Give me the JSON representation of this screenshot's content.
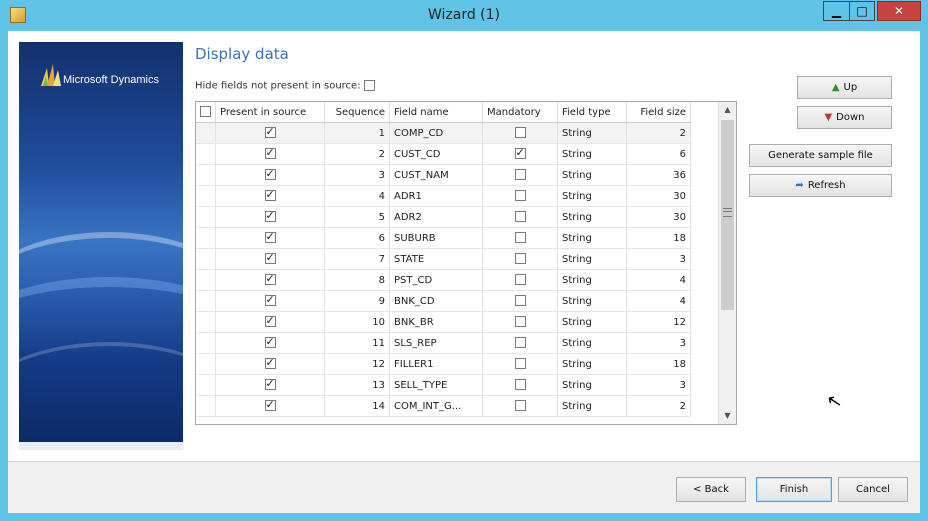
{
  "window": {
    "title": "Wizard (1)",
    "controls": {
      "minimize": "▁",
      "maximize": "□",
      "close": "✕"
    }
  },
  "banner": {
    "logo_text": "Microsoft Dynamics",
    "logo_icon": "microsoft-dynamics-logo-icon"
  },
  "page": {
    "heading": "Display data",
    "hide_fields_label": "Hide fields not present in source:",
    "hide_fields_checked": false
  },
  "grid": {
    "columns": [
      "Present in source",
      "Sequence",
      "Field name",
      "Mandatory",
      "Field type",
      "Field size"
    ],
    "rows": [
      {
        "present": true,
        "sequence": "1",
        "field_name": "COMP_CD",
        "mandatory": false,
        "field_type": "String",
        "field_size": "2"
      },
      {
        "present": true,
        "sequence": "2",
        "field_name": "CUST_CD",
        "mandatory": true,
        "field_type": "String",
        "field_size": "6"
      },
      {
        "present": true,
        "sequence": "3",
        "field_name": "CUST_NAM",
        "mandatory": false,
        "field_type": "String",
        "field_size": "36"
      },
      {
        "present": true,
        "sequence": "4",
        "field_name": "ADR1",
        "mandatory": false,
        "field_type": "String",
        "field_size": "30"
      },
      {
        "present": true,
        "sequence": "5",
        "field_name": "ADR2",
        "mandatory": false,
        "field_type": "String",
        "field_size": "30"
      },
      {
        "present": true,
        "sequence": "6",
        "field_name": "SUBURB",
        "mandatory": false,
        "field_type": "String",
        "field_size": "18"
      },
      {
        "present": true,
        "sequence": "7",
        "field_name": "STATE",
        "mandatory": false,
        "field_type": "String",
        "field_size": "3"
      },
      {
        "present": true,
        "sequence": "8",
        "field_name": "PST_CD",
        "mandatory": false,
        "field_type": "String",
        "field_size": "4"
      },
      {
        "present": true,
        "sequence": "9",
        "field_name": "BNK_CD",
        "mandatory": false,
        "field_type": "String",
        "field_size": "4"
      },
      {
        "present": true,
        "sequence": "10",
        "field_name": "BNK_BR",
        "mandatory": false,
        "field_type": "String",
        "field_size": "12"
      },
      {
        "present": true,
        "sequence": "11",
        "field_name": "SLS_REP",
        "mandatory": false,
        "field_type": "String",
        "field_size": "3"
      },
      {
        "present": true,
        "sequence": "12",
        "field_name": "FILLER1",
        "mandatory": false,
        "field_type": "String",
        "field_size": "18"
      },
      {
        "present": true,
        "sequence": "13",
        "field_name": "SELL_TYPE",
        "mandatory": false,
        "field_type": "String",
        "field_size": "3"
      },
      {
        "present": true,
        "sequence": "14",
        "field_name": "COM_INT_G...",
        "mandatory": false,
        "field_type": "String",
        "field_size": "2"
      }
    ]
  },
  "buttons": {
    "up": "Up",
    "down": "Down",
    "generate": "Generate sample file",
    "refresh": "Refresh",
    "back": "< Back",
    "finish": "Finish",
    "cancel": "Cancel"
  },
  "colors": {
    "title_bar": "#5fc4e6",
    "heading": "#3a73b8",
    "close_button": "#c7433f"
  }
}
